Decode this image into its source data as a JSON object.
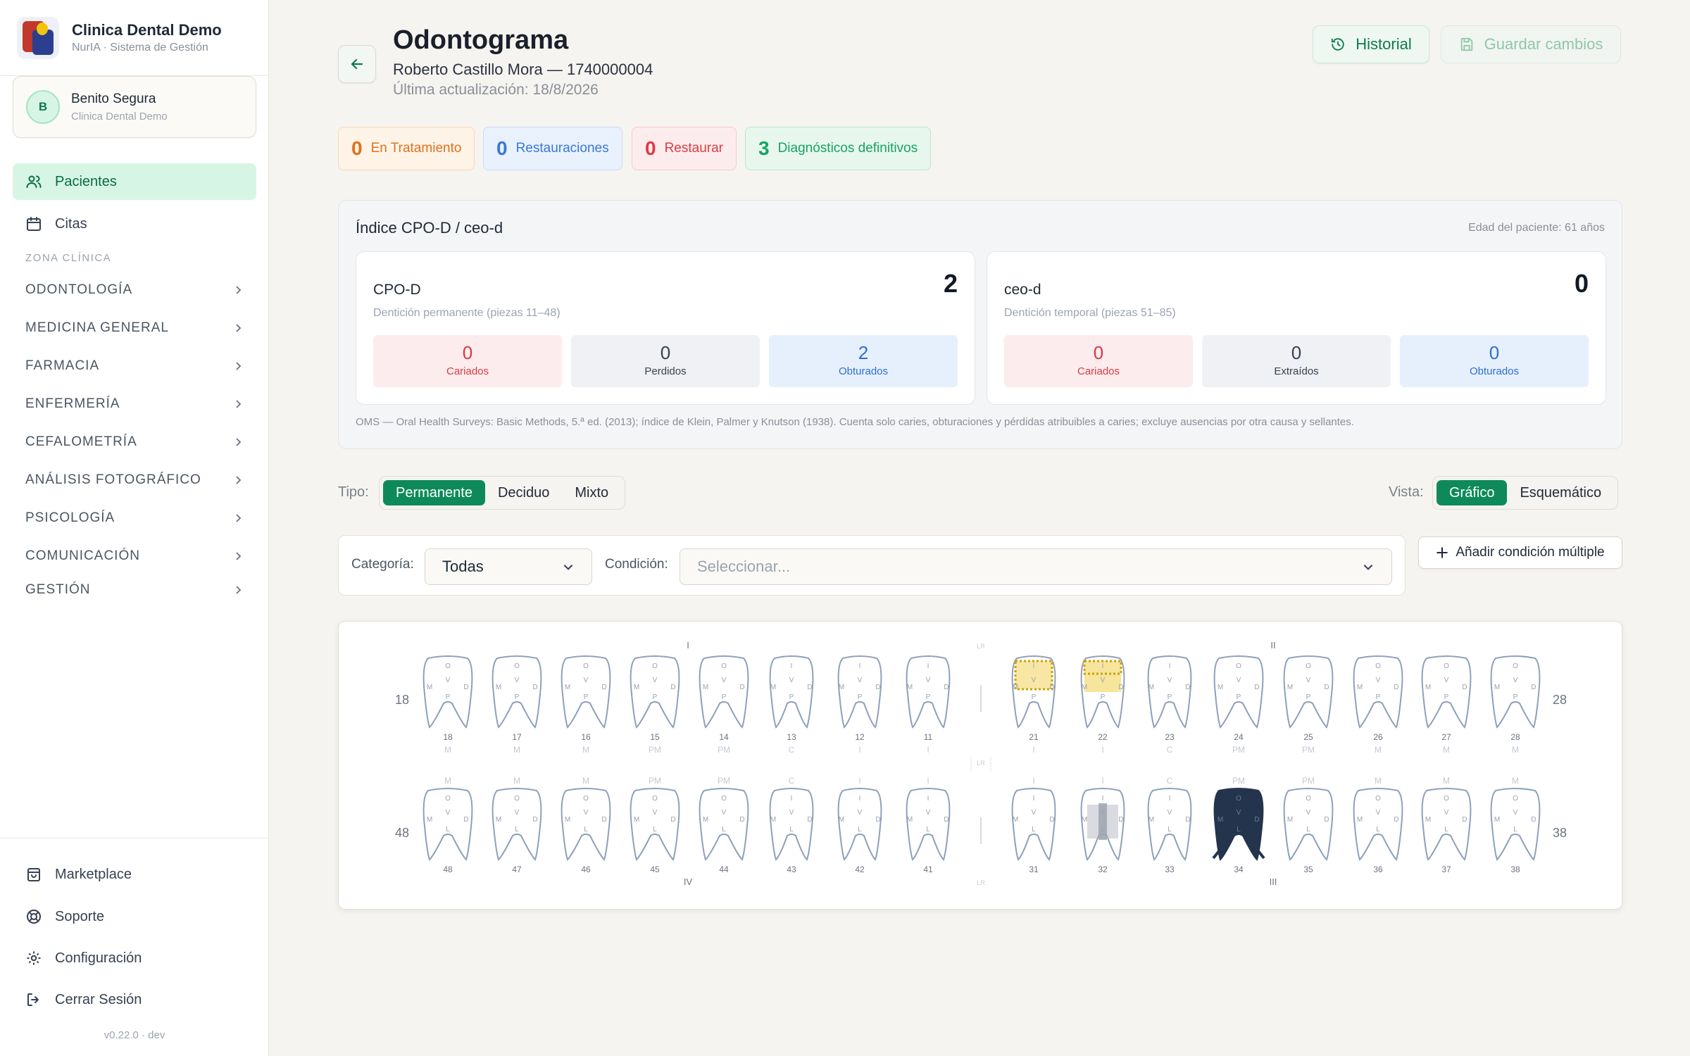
{
  "sidebar": {
    "brand_title": "Clinica Dental Demo",
    "brand_subtitle": "NurIA · Sistema de Gestión",
    "user": {
      "initial": "B",
      "name": "Benito Segura",
      "clinic": "Clinica Dental Demo"
    },
    "nav": [
      {
        "label": "Pacientes",
        "icon": "users-icon",
        "active": true
      },
      {
        "label": "Citas",
        "icon": "calendar-icon",
        "active": false
      }
    ],
    "section_label": "ZONA CLÍNICA",
    "categories": [
      "ODONTOLOGÍA",
      "MEDICINA GENERAL",
      "FARMACIA",
      "ENFERMERÍA",
      "CEFALOMETRÍA",
      "ANÁLISIS FOTOGRÁFICO",
      "PSICOLOGÍA",
      "COMUNICACIÓN",
      "GESTIÓN"
    ],
    "bottom": [
      {
        "label": "Marketplace",
        "icon": "store-icon"
      },
      {
        "label": "Soporte",
        "icon": "lifebuoy-icon"
      },
      {
        "label": "Configuración",
        "icon": "gear-icon"
      },
      {
        "label": "Cerrar Sesión",
        "icon": "logout-icon"
      }
    ],
    "version": "v0.22.0 · dev"
  },
  "header": {
    "title": "Odontograma",
    "patient": "Roberto Castillo Mora — 1740000004",
    "updated": "Última actualización: 18/8/2026",
    "history_label": "Historial",
    "save_label": "Guardar cambios"
  },
  "chips": [
    {
      "count": "0",
      "label": "En Tratamiento",
      "color": "#e0711c"
    },
    {
      "count": "0",
      "label": "Restauraciones",
      "color": "#3a78d6"
    },
    {
      "count": "0",
      "label": "Restaurar",
      "color": "#de3b45"
    },
    {
      "count": "3",
      "label": "Diagnósticos definitivos",
      "color": "#17a363"
    }
  ],
  "cpo": {
    "title": "Índice CPO-D / ceo-d",
    "age": "Edad del paciente: 61 años",
    "permanent": {
      "name": "CPO-D",
      "desc": "Dentición permanente (piezas 11–48)",
      "value": "2",
      "stats": [
        {
          "value": "0",
          "label": "Cariados"
        },
        {
          "value": "0",
          "label": "Perdidos"
        },
        {
          "value": "2",
          "label": "Obturados"
        }
      ]
    },
    "temporary": {
      "name": "ceo-d",
      "desc": "Dentición temporal (piezas 51–85)",
      "value": "0",
      "stats": [
        {
          "value": "0",
          "label": "Cariados"
        },
        {
          "value": "0",
          "label": "Extraídos"
        },
        {
          "value": "0",
          "label": "Obturados"
        }
      ]
    },
    "note": "OMS — Oral Health Surveys: Basic Methods, 5.ª ed. (2013); índice de Klein, Palmer y Knutson (1938). Cuenta solo caries, obturaciones y pérdidas atribuibles a caries; excluye ausencias por otra causa y sellantes."
  },
  "controls": {
    "type_label": "Tipo:",
    "type_options": [
      "Permanente",
      "Deciduo",
      "Mixto"
    ],
    "view_label": "Vista:",
    "view_options": [
      "Gráfico",
      "Esquemático"
    ],
    "category_label": "Categoría:",
    "category_value": "Todas",
    "condition_label": "Condición:",
    "condition_placeholder": "Seleccionar...",
    "add_label": "Añadir condición múltiple"
  },
  "chart": {
    "quadrants": [
      "I",
      "II",
      "III",
      "IV"
    ],
    "midline_label": "LR",
    "side_labels": {
      "upper_left": "18",
      "upper_right": "28",
      "lower_left": "48",
      "lower_right": "38"
    },
    "upper_teeth": [
      {
        "num": "18",
        "type": "M",
        "anterior": false,
        "state": ""
      },
      {
        "num": "17",
        "type": "M",
        "anterior": false,
        "state": ""
      },
      {
        "num": "16",
        "type": "M",
        "anterior": false,
        "state": ""
      },
      {
        "num": "15",
        "type": "PM",
        "anterior": false,
        "state": ""
      },
      {
        "num": "14",
        "type": "PM",
        "anterior": false,
        "state": ""
      },
      {
        "num": "13",
        "type": "C",
        "anterior": true,
        "state": ""
      },
      {
        "num": "12",
        "type": "I",
        "anterior": true,
        "state": ""
      },
      {
        "num": "11",
        "type": "I",
        "anterior": true,
        "state": ""
      },
      {
        "num": "21",
        "type": "I",
        "anterior": true,
        "state": "restored-dotted"
      },
      {
        "num": "22",
        "type": "I",
        "anterior": true,
        "state": "restored-yellow"
      },
      {
        "num": "23",
        "type": "C",
        "anterior": true,
        "state": ""
      },
      {
        "num": "24",
        "type": "PM",
        "anterior": false,
        "state": ""
      },
      {
        "num": "25",
        "type": "PM",
        "anterior": false,
        "state": ""
      },
      {
        "num": "26",
        "type": "M",
        "anterior": false,
        "state": ""
      },
      {
        "num": "27",
        "type": "M",
        "anterior": false,
        "state": ""
      },
      {
        "num": "28",
        "type": "M",
        "anterior": false,
        "state": ""
      }
    ],
    "lower_teeth": [
      {
        "num": "48",
        "type": "M",
        "anterior": false,
        "state": ""
      },
      {
        "num": "47",
        "type": "M",
        "anterior": false,
        "state": ""
      },
      {
        "num": "46",
        "type": "M",
        "anterior": false,
        "state": ""
      },
      {
        "num": "45",
        "type": "PM",
        "anterior": false,
        "state": ""
      },
      {
        "num": "44",
        "type": "PM",
        "anterior": false,
        "state": ""
      },
      {
        "num": "43",
        "type": "C",
        "anterior": true,
        "state": ""
      },
      {
        "num": "42",
        "type": "I",
        "anterior": true,
        "state": ""
      },
      {
        "num": "41",
        "type": "I",
        "anterior": true,
        "state": ""
      },
      {
        "num": "31",
        "type": "I",
        "anterior": true,
        "state": ""
      },
      {
        "num": "32",
        "type": "I",
        "anterior": true,
        "state": "crown-gray"
      },
      {
        "num": "33",
        "type": "C",
        "anterior": true,
        "state": ""
      },
      {
        "num": "34",
        "type": "PM",
        "anterior": false,
        "state": "dark"
      },
      {
        "num": "35",
        "type": "PM",
        "anterior": false,
        "state": ""
      },
      {
        "num": "36",
        "type": "M",
        "anterior": false,
        "state": ""
      },
      {
        "num": "37",
        "type": "M",
        "anterior": false,
        "state": ""
      },
      {
        "num": "38",
        "type": "M",
        "anterior": false,
        "state": ""
      }
    ],
    "colors": {
      "outline": "#8fa0bb",
      "restored": "#f2d35a",
      "dotted": "#c9a000",
      "crown": "#b9bec6",
      "dark": "#24344d"
    }
  }
}
